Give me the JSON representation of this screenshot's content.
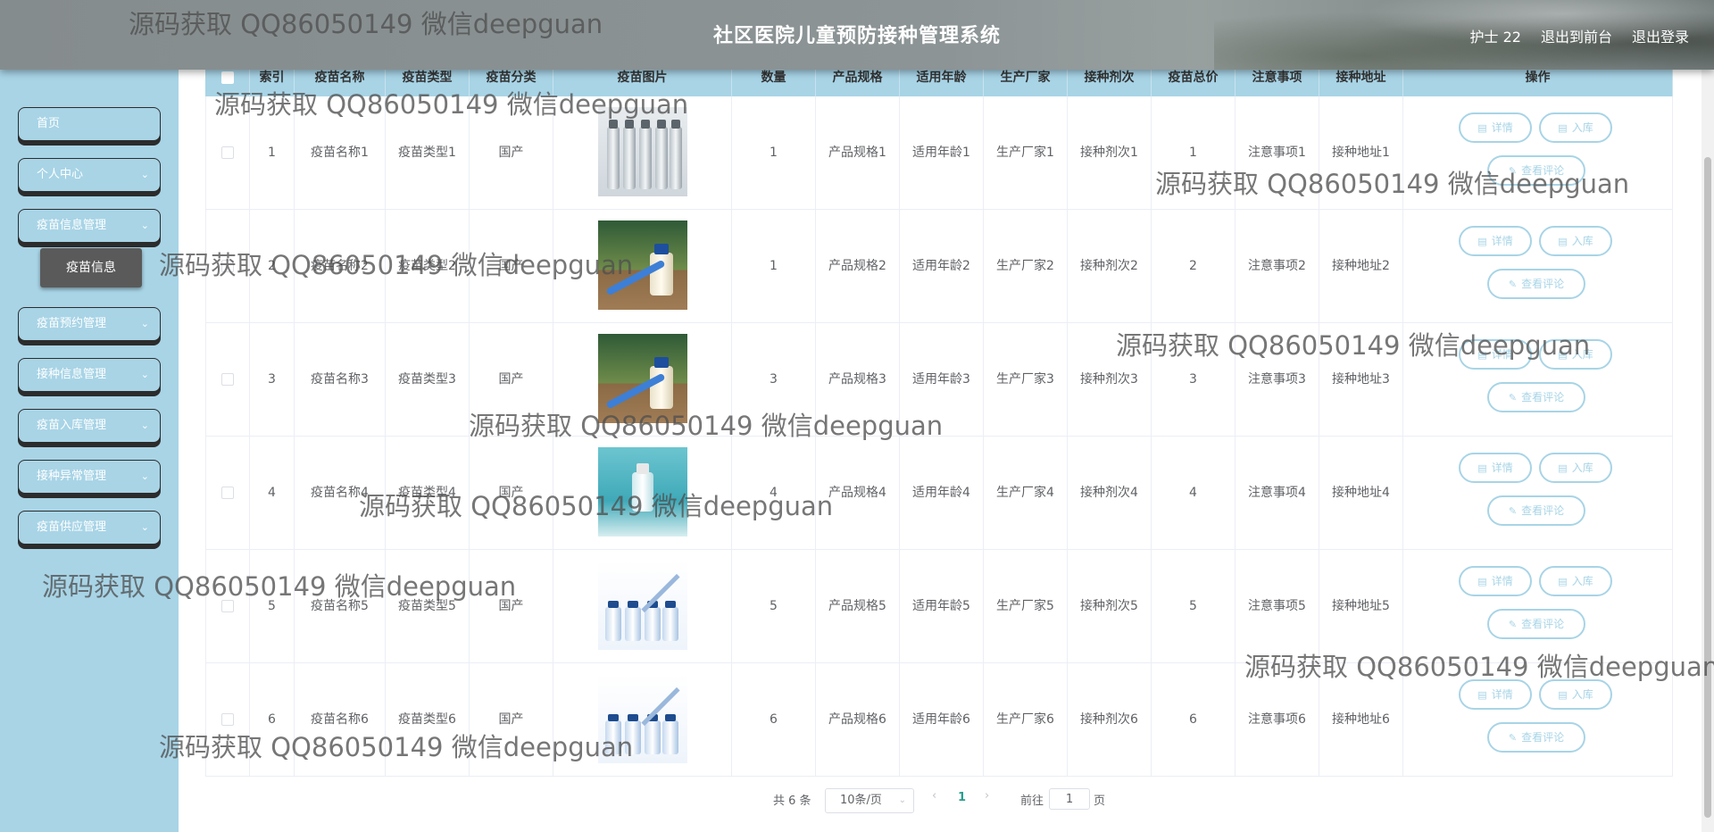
{
  "header": {
    "title": "社区医院儿童预防接种管理系统",
    "user": "护士 22",
    "front_link": "退出到前台",
    "logout_link": "退出登录"
  },
  "sidebar": {
    "items": [
      {
        "label": "首页",
        "has_children": false
      },
      {
        "label": "个人中心",
        "has_children": true
      },
      {
        "label": "疫苗信息管理",
        "has_children": true
      },
      {
        "label": "疫苗预约管理",
        "has_children": true
      },
      {
        "label": "接种信息管理",
        "has_children": true
      },
      {
        "label": "疫苗入库管理",
        "has_children": true
      },
      {
        "label": "接种异常管理",
        "has_children": true
      },
      {
        "label": "疫苗供应管理",
        "has_children": true
      }
    ],
    "active_sub": "疫苗信息"
  },
  "table": {
    "headers": [
      "",
      "索引",
      "疫苗名称",
      "疫苗类型",
      "疫苗分类",
      "疫苗图片",
      "数量",
      "产品规格",
      "适用年龄",
      "生产厂家",
      "接种剂次",
      "疫苗总价",
      "注意事项",
      "接种地址",
      "操作"
    ],
    "rows": [
      {
        "index": "1",
        "name": "疫苗名称1",
        "type": "疫苗类型1",
        "category": "国产",
        "image": "vaccine-vials",
        "qty": "1",
        "spec": "产品规格1",
        "age": "适用年龄1",
        "maker": "生产厂家1",
        "dose": "接种剂次1",
        "price": "1",
        "notes": "注意事项1",
        "address": "接种地址1"
      },
      {
        "index": "2",
        "name": "疫苗名称2",
        "type": "疫苗类型2",
        "category": "国产",
        "image": "syringe-bottle-green",
        "qty": "1",
        "spec": "产品规格2",
        "age": "适用年龄2",
        "maker": "生产厂家2",
        "dose": "接种剂次2",
        "price": "2",
        "notes": "注意事项2",
        "address": "接种地址2"
      },
      {
        "index": "3",
        "name": "疫苗名称3",
        "type": "疫苗类型3",
        "category": "国产",
        "image": "syringe-bottle-green",
        "qty": "3",
        "spec": "产品规格3",
        "age": "适用年龄3",
        "maker": "生产厂家3",
        "dose": "接种剂次3",
        "price": "3",
        "notes": "注意事项3",
        "address": "接种地址3"
      },
      {
        "index": "4",
        "name": "疫苗名称4",
        "type": "疫苗类型4",
        "category": "国产",
        "image": "vial-teal",
        "qty": "4",
        "spec": "产品规格4",
        "age": "适用年龄4",
        "maker": "生产厂家4",
        "dose": "接种剂次4",
        "price": "4",
        "notes": "注意事项4",
        "address": "接种地址4"
      },
      {
        "index": "5",
        "name": "疫苗名称5",
        "type": "疫苗类型5",
        "category": "国产",
        "image": "vials-syringe-white",
        "qty": "5",
        "spec": "产品规格5",
        "age": "适用年龄5",
        "maker": "生产厂家5",
        "dose": "接种剂次5",
        "price": "5",
        "notes": "注意事项5",
        "address": "接种地址5"
      },
      {
        "index": "6",
        "name": "疫苗名称6",
        "type": "疫苗类型6",
        "category": "国产",
        "image": "vials-syringe-white",
        "qty": "6",
        "spec": "产品规格6",
        "age": "适用年龄6",
        "maker": "生产厂家6",
        "dose": "接种剂次6",
        "price": "6",
        "notes": "注意事项6",
        "address": "接种地址6"
      }
    ],
    "actions": {
      "detail": "详情",
      "stock_in": "入库",
      "comments": "查看评论"
    }
  },
  "pagination": {
    "total": "共 6 条",
    "page_size": "10条/页",
    "current_page": "1",
    "goto_label": "前往",
    "goto_value": "1",
    "page_suffix": "页"
  },
  "watermark": "源码获取 QQ86050149 微信deepguan",
  "colors": {
    "accent": "#a8d4e6",
    "header": "#8c9496",
    "submenu_active": "#5a5a5a"
  }
}
